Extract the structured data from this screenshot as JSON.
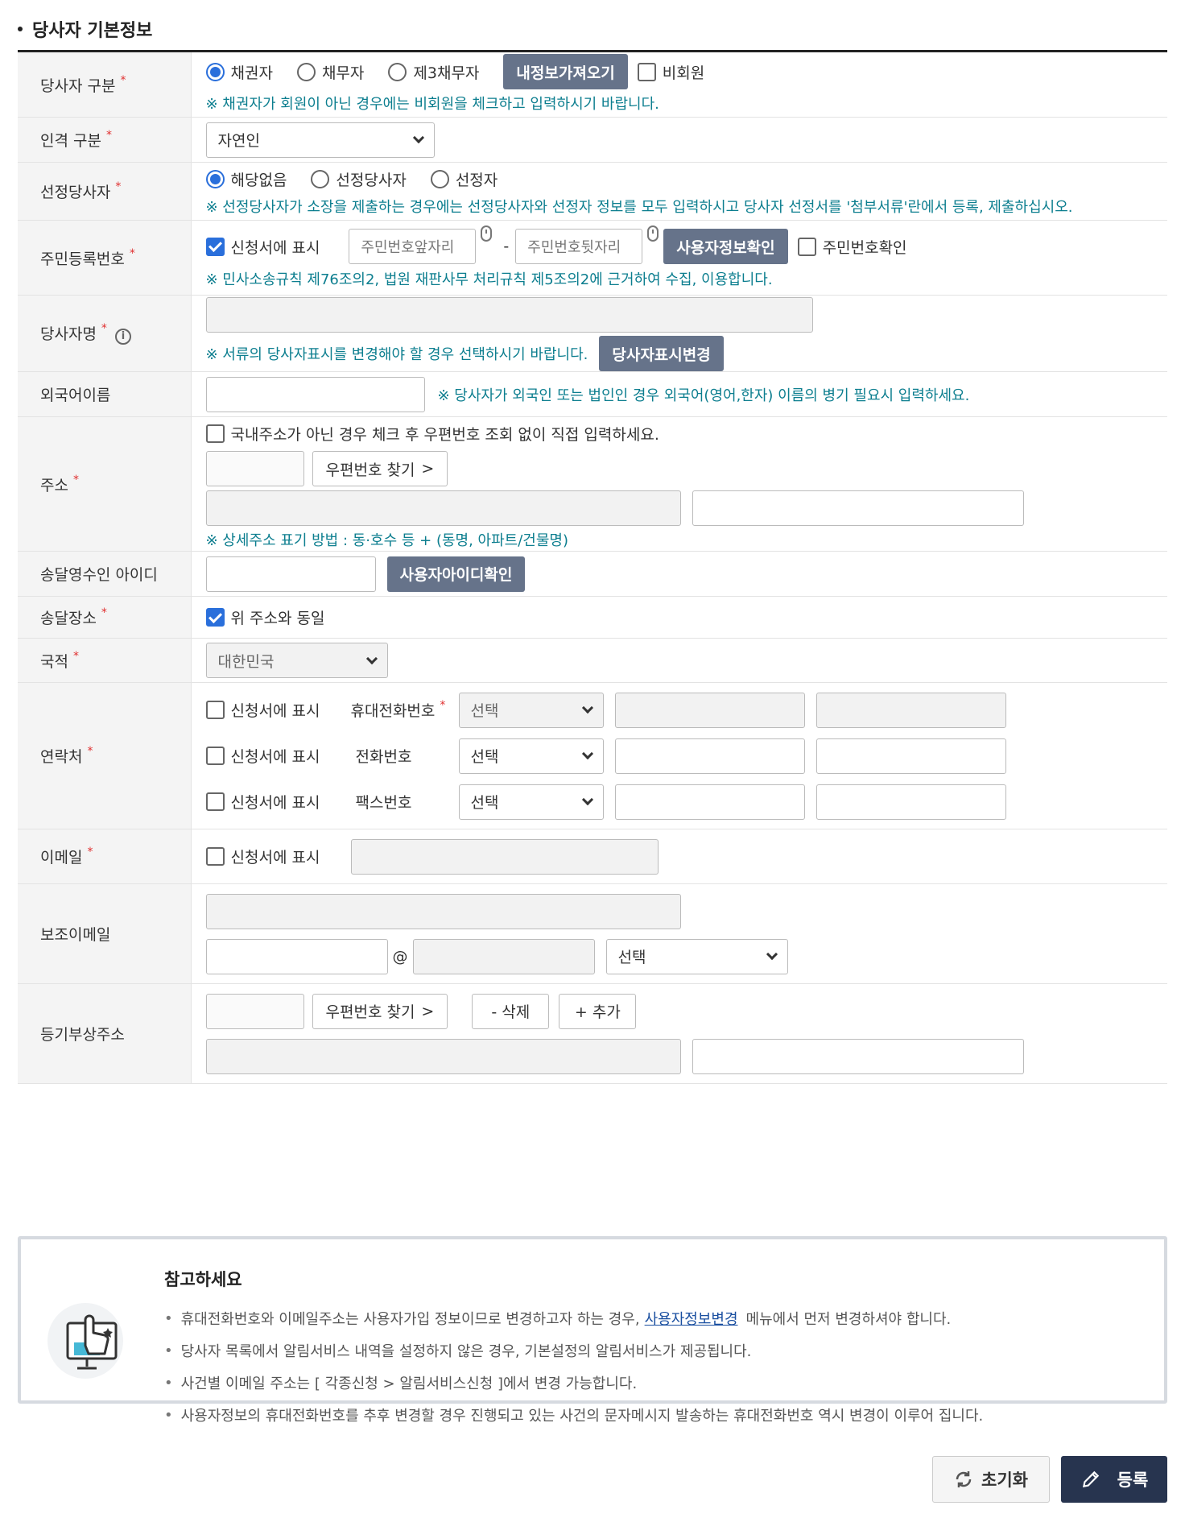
{
  "section_title": "당사자 기본정보",
  "party_type": {
    "label": "당사자 구분",
    "options": [
      "채권자",
      "채무자",
      "제3채무자"
    ],
    "load_button": "내정보가져오기",
    "nonmember_label": "비회원",
    "note": "※ 채권자가 회원이 아닌 경우에는 비회원을 체크하고 입력하시기 바랍니다."
  },
  "person_type": {
    "label": "인격 구분",
    "value": "자연인"
  },
  "designated": {
    "label": "선정당사자",
    "options": [
      "해당없음",
      "선정당사자",
      "선정자"
    ],
    "note": "※ 선정당사자가 소장을 제출하는 경우에는 선정당사자와 선정자 정보를 모두 입력하시고 당사자 선정서를 '첨부서류'란에서 등록, 제출하십시오."
  },
  "resident_no": {
    "label": "주민등록번호",
    "show_label": "신청서에 표시",
    "front_placeholder": "주민번호앞자리",
    "dash": "-",
    "back_placeholder": "주민번호뒷자리",
    "verify_button": "사용자정보확인",
    "confirm_label": "주민번호확인",
    "note": "※ 민사소송규칙 제76조의2, 법원 재판사무 처리규칙 제5조의2에 근거하여 수집, 이용합니다."
  },
  "party_name": {
    "label": "당사자명",
    "note": "※ 서류의 당사자표시를 변경해야 할 경우 선택하시기 바랍니다.",
    "change_button": "당사자표시변경"
  },
  "foreign_name": {
    "label": "외국어이름",
    "note": "※ 당사자가 외국인 또는 법인인 경우 외국어(영어,한자) 이름의 병기 필요시 입력하세요."
  },
  "address": {
    "label": "주소",
    "overseas_label": "국내주소가 아닌 경우 체크 후 우편번호 조회 없이 직접 입력하세요.",
    "zip_button": "우편번호 찾기",
    "note": "※ 상세주소 표기 방법 : 동·호수 등 + (동명, 아파트/건물명)"
  },
  "recipient_id": {
    "label": "송달영수인 아이디",
    "verify_button": "사용자아이디확인"
  },
  "delivery_place": {
    "label": "송달장소",
    "same_label": "위 주소와 동일"
  },
  "nationality": {
    "label": "국적",
    "value": "대한민국"
  },
  "contact": {
    "label": "연락처",
    "rows": [
      {
        "show_label": "신청서에 표시",
        "type": "휴대전화번호",
        "select": "선택"
      },
      {
        "show_label": "신청서에 표시",
        "type": "전화번호",
        "select": "선택"
      },
      {
        "show_label": "신청서에 표시",
        "type": "팩스번호",
        "select": "선택"
      }
    ]
  },
  "email": {
    "label": "이메일",
    "show_label": "신청서에 표시"
  },
  "sub_email": {
    "label": "보조이메일",
    "at": "@",
    "domain_select": "선택"
  },
  "reg_address": {
    "label": "등기부상주소",
    "zip_button": "우편번호 찾기",
    "delete_button": "- 삭제",
    "add_button": "+ 추가"
  },
  "reference": {
    "title": "참고하세요",
    "items": [
      {
        "before": "휴대전화번호와 이메일주소는 사용자가입 정보이므로 변경하고자 하는 경우,",
        "link": "사용자정보변경",
        "after": "메뉴에서 먼저 변경하셔야 합니다."
      },
      {
        "before": "당사자 목록에서 알림서비스 내역을 설정하지 않은 경우, 기본설정의 알림서비스가 제공됩니다."
      },
      {
        "before": "사건별 이메일 주소는 [ 각종신청 > 알림서비스신청 ]에서 변경 가능합니다."
      },
      {
        "before": "사용자정보의 휴대전화번호를 추후 변경할 경우 진행되고 있는 사건의 문자메시지 발송하는 휴대전화번호 역시 변경이 이루어 집니다."
      }
    ]
  },
  "actions": {
    "reset": "초기화",
    "submit": "등록"
  },
  "required_mark": "*",
  "colors": {
    "accent": "#2a6fdb",
    "note": "#0c7e8f",
    "dark_button": "#66738a",
    "submit_bg": "#27344f"
  }
}
